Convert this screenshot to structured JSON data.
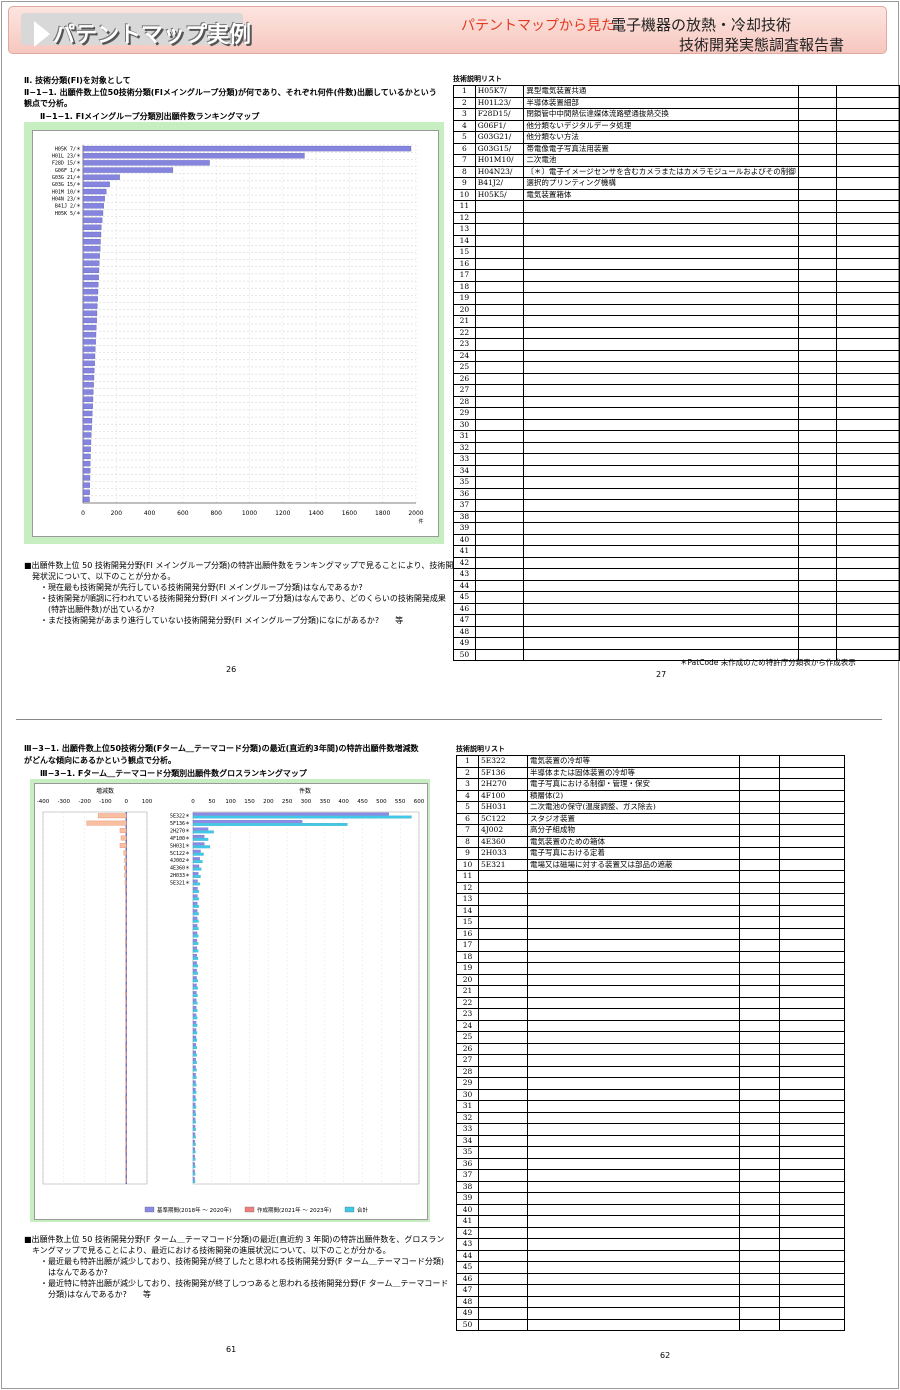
{
  "header": {
    "badge": "パテントマップ実例",
    "sub_red": "パテントマップから見た",
    "sub_title": "電子機器の放熱・冷却技術",
    "sub_title2": "技術開発実態調査報告書"
  },
  "top": {
    "section": "Ⅱ. 技術分類(FI)を対象として",
    "heading1": "Ⅱ−1−1. 出願件数上位50技術分類(FIメイングループ分類)が何であり、それぞれ何件(件数)出願しているかという",
    "heading2": "観点で分析。",
    "caption": "Ⅱ−1−1. FIメイングループ分類別出願件数ランキングマップ",
    "body": [
      "■出願件数上位 50 技術開発分野(FI メイングループ分類)の特許出願件数をランキングマップで見ることにより、技術開",
      "発状況について、以下のことが分かる。",
      "・現在最も技術開発が先行している技術開発分野(FI メイングループ分類)はなんであるか?",
      "・技術開発が順調に行われている技術開発分野(FI メイングループ分類)はなんであり、どのくらいの技術開発成果",
      "(特許出願件数)が出ているか?",
      "・まだ技術開発があまり進行していない技術開発分野(FI メイングループ分類)になにがあるか?　　等"
    ],
    "page_left": "26",
    "page_right": "27",
    "list_title": "技術説明リスト",
    "footnote": "＊PatCode 未作成のため特許庁分類表から作成表示",
    "rows": [
      {
        "n": "1",
        "code": "H05K7/",
        "desc": "異型電気装置共通"
      },
      {
        "n": "2",
        "code": "H01L23/",
        "desc": "半導体装置細部"
      },
      {
        "n": "3",
        "code": "F28D15/",
        "desc": "閉鎖管中中間熱伝達媒体流路壁通抜熱交換"
      },
      {
        "n": "4",
        "code": "G06F1/",
        "desc": "他分類ないデジタルデータ処理"
      },
      {
        "n": "5",
        "code": "G03G21/",
        "desc": "他分類ない方法"
      },
      {
        "n": "6",
        "code": "G03G15/",
        "desc": "帯電像電子写真法用装置"
      },
      {
        "n": "7",
        "code": "H01M10/",
        "desc": "二次電池"
      },
      {
        "n": "8",
        "code": "H04N23/",
        "desc": "〔＊〕電子イメージセンサを含むカメラまたはカメラモジュールおよびその制御"
      },
      {
        "n": "9",
        "code": "B41J2/",
        "desc": "選択的プリンティング機構"
      },
      {
        "n": "10",
        "code": "H05K5/",
        "desc": "電気装置箱体"
      },
      {
        "n": "11",
        "code": "",
        "desc": ""
      },
      {
        "n": "12",
        "code": "",
        "desc": ""
      },
      {
        "n": "13",
        "code": "",
        "desc": ""
      },
      {
        "n": "14",
        "code": "",
        "desc": ""
      },
      {
        "n": "15",
        "code": "",
        "desc": ""
      },
      {
        "n": "16",
        "code": "",
        "desc": ""
      },
      {
        "n": "17",
        "code": "",
        "desc": ""
      },
      {
        "n": "18",
        "code": "",
        "desc": ""
      },
      {
        "n": "19",
        "code": "",
        "desc": ""
      },
      {
        "n": "20",
        "code": "",
        "desc": ""
      },
      {
        "n": "21",
        "code": "",
        "desc": ""
      },
      {
        "n": "22",
        "code": "",
        "desc": ""
      },
      {
        "n": "23",
        "code": "",
        "desc": ""
      },
      {
        "n": "24",
        "code": "",
        "desc": ""
      },
      {
        "n": "25",
        "code": "",
        "desc": ""
      },
      {
        "n": "26",
        "code": "",
        "desc": ""
      },
      {
        "n": "27",
        "code": "",
        "desc": ""
      },
      {
        "n": "28",
        "code": "",
        "desc": ""
      },
      {
        "n": "29",
        "code": "",
        "desc": ""
      },
      {
        "n": "30",
        "code": "",
        "desc": ""
      },
      {
        "n": "31",
        "code": "",
        "desc": ""
      },
      {
        "n": "32",
        "code": "",
        "desc": ""
      },
      {
        "n": "33",
        "code": "",
        "desc": ""
      },
      {
        "n": "34",
        "code": "",
        "desc": ""
      },
      {
        "n": "35",
        "code": "",
        "desc": ""
      },
      {
        "n": "36",
        "code": "",
        "desc": ""
      },
      {
        "n": "37",
        "code": "",
        "desc": ""
      },
      {
        "n": "38",
        "code": "",
        "desc": ""
      },
      {
        "n": "39",
        "code": "",
        "desc": ""
      },
      {
        "n": "40",
        "code": "",
        "desc": ""
      },
      {
        "n": "41",
        "code": "",
        "desc": ""
      },
      {
        "n": "42",
        "code": "",
        "desc": ""
      },
      {
        "n": "43",
        "code": "",
        "desc": ""
      },
      {
        "n": "44",
        "code": "",
        "desc": ""
      },
      {
        "n": "45",
        "code": "",
        "desc": ""
      },
      {
        "n": "46",
        "code": "",
        "desc": ""
      },
      {
        "n": "47",
        "code": "",
        "desc": ""
      },
      {
        "n": "48",
        "code": "",
        "desc": ""
      },
      {
        "n": "49",
        "code": "",
        "desc": ""
      },
      {
        "n": "50",
        "code": "",
        "desc": ""
      }
    ]
  },
  "bottom": {
    "heading1": "Ⅲ−3−1. 出願件数上位50技術分類(Fターム＿テーマコード分類)の最近(直近約3年間)の特許出願件数増減数",
    "heading2": "がどんな傾向にあるかという観点で分析。",
    "caption": "Ⅲ−3−1. Fターム＿テーマコード分類別出願件数グロスランキングマップ",
    "body": [
      "■出願件数上位 50 技術開発分野(F ターム＿テーマコード分類)の最近(直近約 3 年間)の特許出願件数を、グロスラン",
      "キングマップで見ることにより、最近における技術開発の進展状況について、以下のことが分かる。",
      "・最近最も特許出願が減少しており、技術開発が終了したと思われる技術開発分野(F ターム＿テーマコード分類)",
      "はなんであるか?",
      "・最近特に特許出願が減少しており、技術開発が終了しつつあると思われる技術開発分野(F ターム＿テーマコード",
      "分類)はなんであるか?　　等"
    ],
    "page_left": "61",
    "page_right": "62",
    "list_title": "技術説明リスト",
    "rows": [
      {
        "n": "1",
        "code": "5E322",
        "desc": "電気装置の冷却等"
      },
      {
        "n": "2",
        "code": "5F136",
        "desc": "半導体または固体装置の冷却等"
      },
      {
        "n": "3",
        "code": "2H270",
        "desc": "電子写真における制御・管理・保安"
      },
      {
        "n": "4",
        "code": "4F100",
        "desc": "積層体(2)"
      },
      {
        "n": "5",
        "code": "5H031",
        "desc": "二次電池の保守(温度調整、ガス除去)"
      },
      {
        "n": "6",
        "code": "5C122",
        "desc": "スタジオ装置"
      },
      {
        "n": "7",
        "code": "4J002",
        "desc": "高分子組成物"
      },
      {
        "n": "8",
        "code": "4E360",
        "desc": "電気装置のための箱体"
      },
      {
        "n": "9",
        "code": "2H033",
        "desc": "電子写真における定着"
      },
      {
        "n": "10",
        "code": "5E321",
        "desc": "電場又は磁場に対する装置又は部品の遮蔽"
      },
      {
        "n": "11",
        "code": "",
        "desc": ""
      },
      {
        "n": "12",
        "code": "",
        "desc": ""
      },
      {
        "n": "13",
        "code": "",
        "desc": ""
      },
      {
        "n": "14",
        "code": "",
        "desc": ""
      },
      {
        "n": "15",
        "code": "",
        "desc": ""
      },
      {
        "n": "16",
        "code": "",
        "desc": ""
      },
      {
        "n": "17",
        "code": "",
        "desc": ""
      },
      {
        "n": "18",
        "code": "",
        "desc": ""
      },
      {
        "n": "19",
        "code": "",
        "desc": ""
      },
      {
        "n": "20",
        "code": "",
        "desc": ""
      },
      {
        "n": "21",
        "code": "",
        "desc": ""
      },
      {
        "n": "22",
        "code": "",
        "desc": ""
      },
      {
        "n": "23",
        "code": "",
        "desc": ""
      },
      {
        "n": "24",
        "code": "",
        "desc": ""
      },
      {
        "n": "25",
        "code": "",
        "desc": ""
      },
      {
        "n": "26",
        "code": "",
        "desc": ""
      },
      {
        "n": "27",
        "code": "",
        "desc": ""
      },
      {
        "n": "28",
        "code": "",
        "desc": ""
      },
      {
        "n": "29",
        "code": "",
        "desc": ""
      },
      {
        "n": "30",
        "code": "",
        "desc": ""
      },
      {
        "n": "31",
        "code": "",
        "desc": ""
      },
      {
        "n": "32",
        "code": "",
        "desc": ""
      },
      {
        "n": "33",
        "code": "",
        "desc": ""
      },
      {
        "n": "34",
        "code": "",
        "desc": ""
      },
      {
        "n": "35",
        "code": "",
        "desc": ""
      },
      {
        "n": "36",
        "code": "",
        "desc": ""
      },
      {
        "n": "37",
        "code": "",
        "desc": ""
      },
      {
        "n": "38",
        "code": "",
        "desc": ""
      },
      {
        "n": "39",
        "code": "",
        "desc": ""
      },
      {
        "n": "40",
        "code": "",
        "desc": ""
      },
      {
        "n": "41",
        "code": "",
        "desc": ""
      },
      {
        "n": "42",
        "code": "",
        "desc": ""
      },
      {
        "n": "43",
        "code": "",
        "desc": ""
      },
      {
        "n": "44",
        "code": "",
        "desc": ""
      },
      {
        "n": "45",
        "code": "",
        "desc": ""
      },
      {
        "n": "46",
        "code": "",
        "desc": ""
      },
      {
        "n": "47",
        "code": "",
        "desc": ""
      },
      {
        "n": "48",
        "code": "",
        "desc": ""
      },
      {
        "n": "49",
        "code": "",
        "desc": ""
      },
      {
        "n": "50",
        "code": "",
        "desc": ""
      }
    ]
  },
  "chart_data": [
    {
      "type": "bar",
      "orientation": "horizontal",
      "categories": [
        "H05K 7/＊",
        "H01L 23/＊",
        "F28D 15/＊",
        "G06F 1/＊",
        "G03G 21/＊",
        "G03G 15/＊",
        "H01M 10/＊",
        "H04N 23/＊",
        "B41J 2/＊",
        "H05K 5/＊"
      ],
      "values": [
        1970,
        1330,
        760,
        540,
        220,
        160,
        140,
        130,
        125,
        120,
        115,
        110,
        108,
        105,
        103,
        100,
        98,
        96,
        94,
        92,
        90,
        88,
        86,
        84,
        82,
        80,
        78,
        76,
        74,
        72,
        70,
        68,
        66,
        64,
        62,
        60,
        58,
        56,
        54,
        52,
        50,
        48,
        46,
        45,
        44,
        43,
        42,
        41,
        40,
        39
      ],
      "xlim": [
        0,
        2000
      ],
      "xticks": [
        "0",
        "200",
        "400",
        "600",
        "800",
        "1000",
        "1200",
        "1400",
        "1600",
        "1800",
        "2000"
      ],
      "xunit": "件",
      "grid": true
    },
    {
      "type": "bar",
      "orientation": "horizontal",
      "categories": [
        "5E322＊",
        "5F136＊",
        "2H270＊",
        "4F100＊",
        "5H031＊",
        "5C122＊",
        "4J002＊",
        "4E360＊",
        "2H033＊",
        "5E321＊"
      ],
      "left_title": "増減数",
      "left_xlim": [
        -400,
        100
      ],
      "left_xticks": [
        "-400",
        "-300",
        "-200",
        "-100",
        "0",
        "100"
      ],
      "diff": [
        -135,
        -190,
        -30,
        -25,
        -30,
        -12,
        -8,
        -10,
        -8,
        -6
      ],
      "right_title": "件数",
      "right_xlim": [
        0,
        600
      ],
      "right_xticks": [
        "0",
        "50",
        "100",
        "150",
        "200",
        "250",
        "300",
        "350",
        "400",
        "450",
        "500",
        "550",
        "600"
      ],
      "series": [
        {
          "name": "基準期間(2018年 ～ 2020年)",
          "color": "#8a8ae8",
          "values": [
            520,
            290,
            40,
            30,
            30,
            20,
            18,
            16,
            14,
            12
          ]
        },
        {
          "name": "作成期間(2021年 ～ 2023年)",
          "color": "#f08080",
          "values": [
            0,
            0,
            0,
            0,
            0,
            0,
            0,
            0,
            0,
            0
          ]
        },
        {
          "name": "合計",
          "color": "#40c8e8",
          "values": [
            580,
            410,
            55,
            40,
            45,
            28,
            25,
            22,
            20,
            18
          ]
        }
      ],
      "grid": true
    }
  ]
}
